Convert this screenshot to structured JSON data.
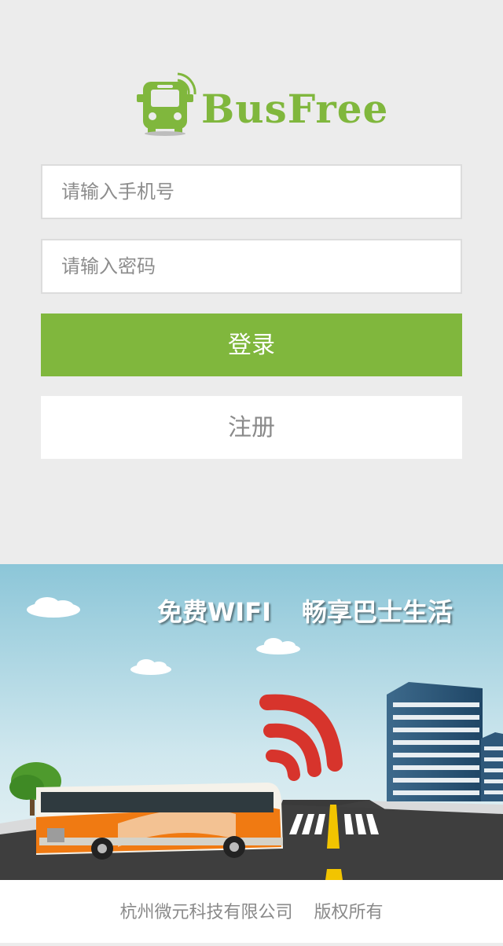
{
  "logo": {
    "icon": "bus-wifi-icon",
    "brand_text": "BusFree"
  },
  "form": {
    "phone_placeholder": "请输入手机号",
    "password_placeholder": "请输入密码",
    "login_label": "登录",
    "register_label": "注册"
  },
  "banner": {
    "slogan_1": "免费WIFI",
    "slogan_2": "畅享巴士生活",
    "illustration": "bus-city-road-wifi-illustration"
  },
  "footer": {
    "company": "杭州微元科技有限公司",
    "rights": "版权所有"
  },
  "colors": {
    "brand_green": "#80b73d",
    "background": "#ececec",
    "sky_top": "#8cc6d8",
    "bus_orange": "#f07a12",
    "wifi_red": "#d7342c"
  }
}
